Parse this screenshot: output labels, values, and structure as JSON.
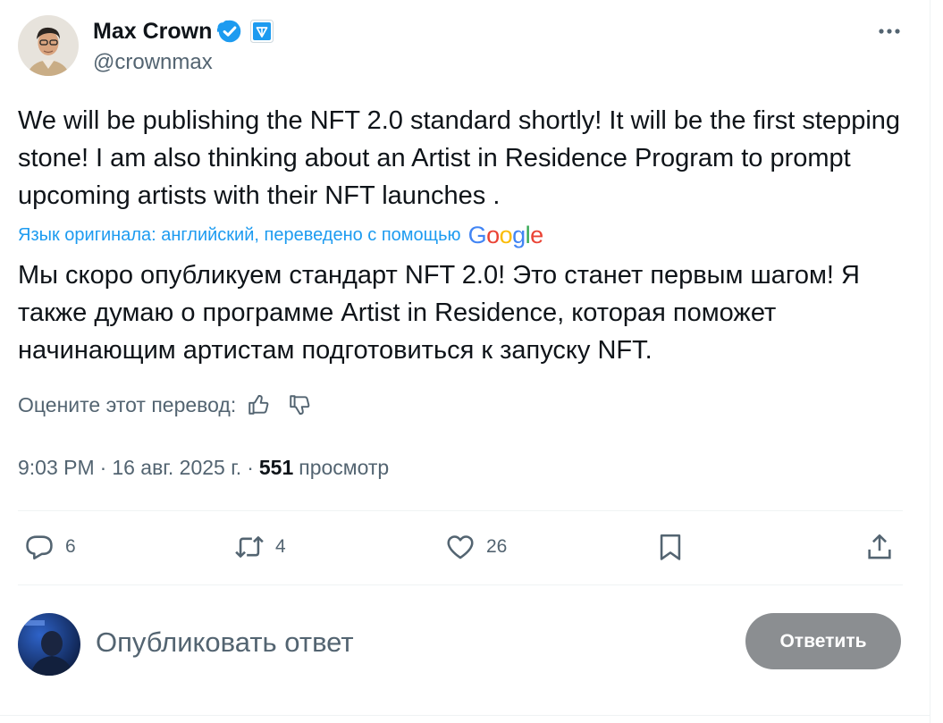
{
  "author": {
    "display_name": "Max Crown",
    "handle": "@crownmax"
  },
  "tweet": {
    "text": "We will be publishing the NFT 2.0 standard shortly! It will be the first stepping stone! I am also thinking about an Artist in Residence Program to prompt upcoming artists with their NFT launches .",
    "translation_note": "Язык оригинала: английский, переведено с помощью",
    "translation_provider": "Google",
    "translated_text": "Мы скоро опубликуем стандарт NFT 2.0! Это станет первым шагом! Я также думаю о программе Artist in Residence, которая поможет начинающим артистам подготовиться к запуску NFT.",
    "rate_label": "Оцените этот перевод:",
    "time": "9:03 PM",
    "date": "16 авг. 2025 г.",
    "separator": "·",
    "views_count": "551",
    "views_label": "просмотр"
  },
  "actions": {
    "replies": "6",
    "reposts": "4",
    "likes": "26"
  },
  "reply": {
    "placeholder": "Опубликовать ответ",
    "button_label": "Ответить"
  },
  "colors": {
    "accent": "#1d9bf0",
    "secondary_text": "#536471",
    "reply_button": "#8b8e91"
  },
  "icons": [
    "verified-badge-icon",
    "affiliate-badge-icon",
    "more-icon",
    "thumbs-up-icon",
    "thumbs-down-icon",
    "reply-icon",
    "repost-icon",
    "like-icon",
    "bookmark-icon",
    "share-icon"
  ]
}
